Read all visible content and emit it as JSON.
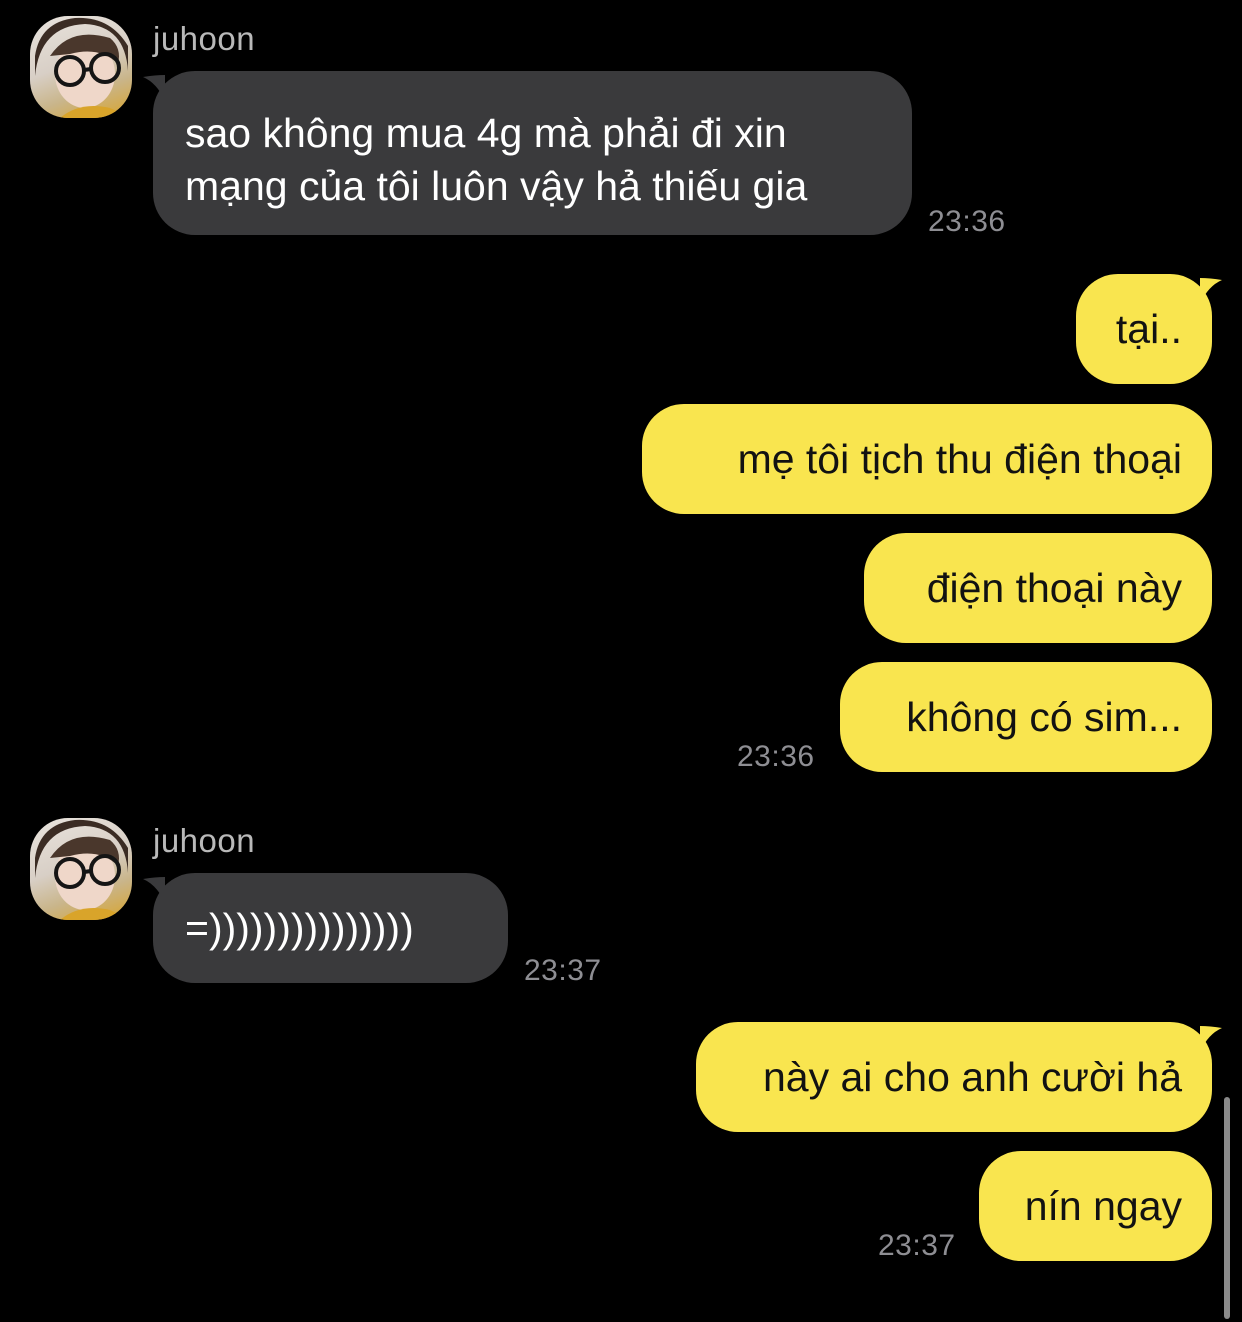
{
  "colors": {
    "background": "#000000",
    "incoming_bubble": "#3a3a3c",
    "outgoing_bubble": "#f9e54f",
    "timestamp": "#8e8e93",
    "sender_name": "#b9b9b9"
  },
  "messages": {
    "group1": {
      "sender": "juhoon",
      "avatar_icon": "profile-photo-icon",
      "line1": "sao không mua 4g mà phải đi xin",
      "line2": "mạng của tôi luôn vậy hả thiếu gia",
      "time": "23:36"
    },
    "group2": {
      "msg1": "tại..",
      "msg2": "mẹ tôi tịch thu điện thoại",
      "msg3": "điện thoại này",
      "msg4": "không có sim...",
      "time": "23:36"
    },
    "group3": {
      "sender": "juhoon",
      "avatar_icon": "profile-photo-icon",
      "msg1": "=)))))))))))))))",
      "time": "23:37"
    },
    "group4": {
      "msg1": "này ai cho anh cười hả",
      "msg2": "nín ngay",
      "time": "23:37"
    }
  }
}
